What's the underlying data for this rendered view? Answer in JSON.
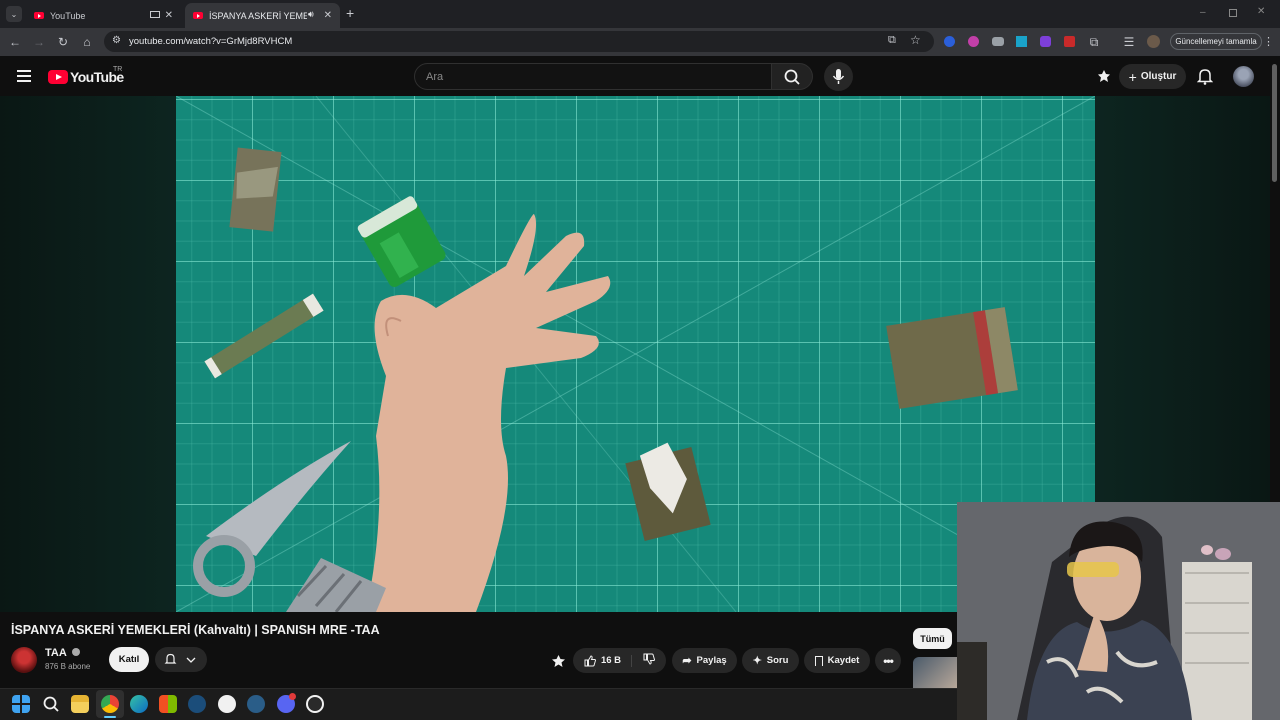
{
  "browser": {
    "tabs": [
      {
        "label": "YouTube",
        "active": false
      },
      {
        "label": "İSPANYA ASKERİ YEMEKLERİ",
        "active": true
      }
    ],
    "url": "youtube.com/watch?v=GrMjd8RVHCM",
    "update_button": "Güncellemeyi tamamla",
    "accent": "#35363a"
  },
  "youtube": {
    "logo_text": "YouTube",
    "region": "TR",
    "search_placeholder": "Ara",
    "create_label": "Oluştur",
    "brand_color": "#ff0033"
  },
  "video": {
    "title": "İSPANYA ASKERİ YEMEKLERİ (Kahvaltı) | SPANISH MRE -TAA",
    "mat_color": "#15897a"
  },
  "channel": {
    "name": "TAA",
    "subscribers": "876 B abone",
    "join_label": "Katıl"
  },
  "actions": {
    "likes": "16 B",
    "share": "Paylaş",
    "ask": "Soru",
    "save": "Kaydet"
  },
  "sidebar": {
    "filter_all": "Tümü"
  },
  "taskbar": {
    "apps": [
      "windows-start",
      "search",
      "file-explorer",
      "chrome",
      "edge",
      "store",
      "steam",
      "yandex",
      "steam-2",
      "discord",
      "obs"
    ]
  }
}
